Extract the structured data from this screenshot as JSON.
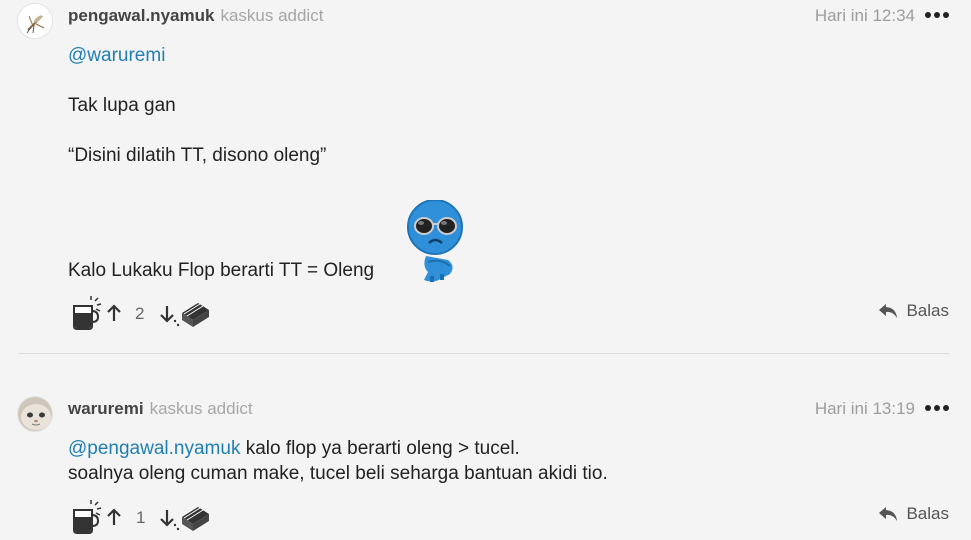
{
  "posts": [
    {
      "username": "pengawal.nyamuk",
      "rank": "kaskus addict",
      "time": "Hari ini 12:34",
      "mention": "@waruremi",
      "lines": [
        "Tak lupa gan",
        "“Disini dilatih TT, disono oleng”",
        "Kalo Lukaku Flop berarti TT = Oleng"
      ],
      "vote_count": "2",
      "reply_label": "Balas",
      "avatar_icon": "mosquito-avatar",
      "emoji_icon": "sunglasses-blue-emoticon"
    },
    {
      "username": "waruremi",
      "rank": "kaskus addict",
      "time": "Hari ini 13:19",
      "mention": "@pengawal.nyamuk",
      "mention_rest": " kalo flop ya berarti oleng > tucel.",
      "lines": [
        "soalnya oleng cuman make, tucel beli seharga bantuan akidi tio."
      ],
      "vote_count": "1",
      "reply_label": "Balas",
      "avatar_icon": "cat-face-avatar"
    }
  ],
  "icons": {
    "cendol": "hot-cup-icon",
    "upvote": "arrow-up-icon",
    "downvote": "arrow-down-icon",
    "bata": "brick-icon",
    "reply": "reply-arrow-icon",
    "more": "more-dots-icon"
  },
  "colors": {
    "link": "#1f7fb3",
    "rank": "#a6a6a6",
    "background": "#f4f4f4"
  }
}
